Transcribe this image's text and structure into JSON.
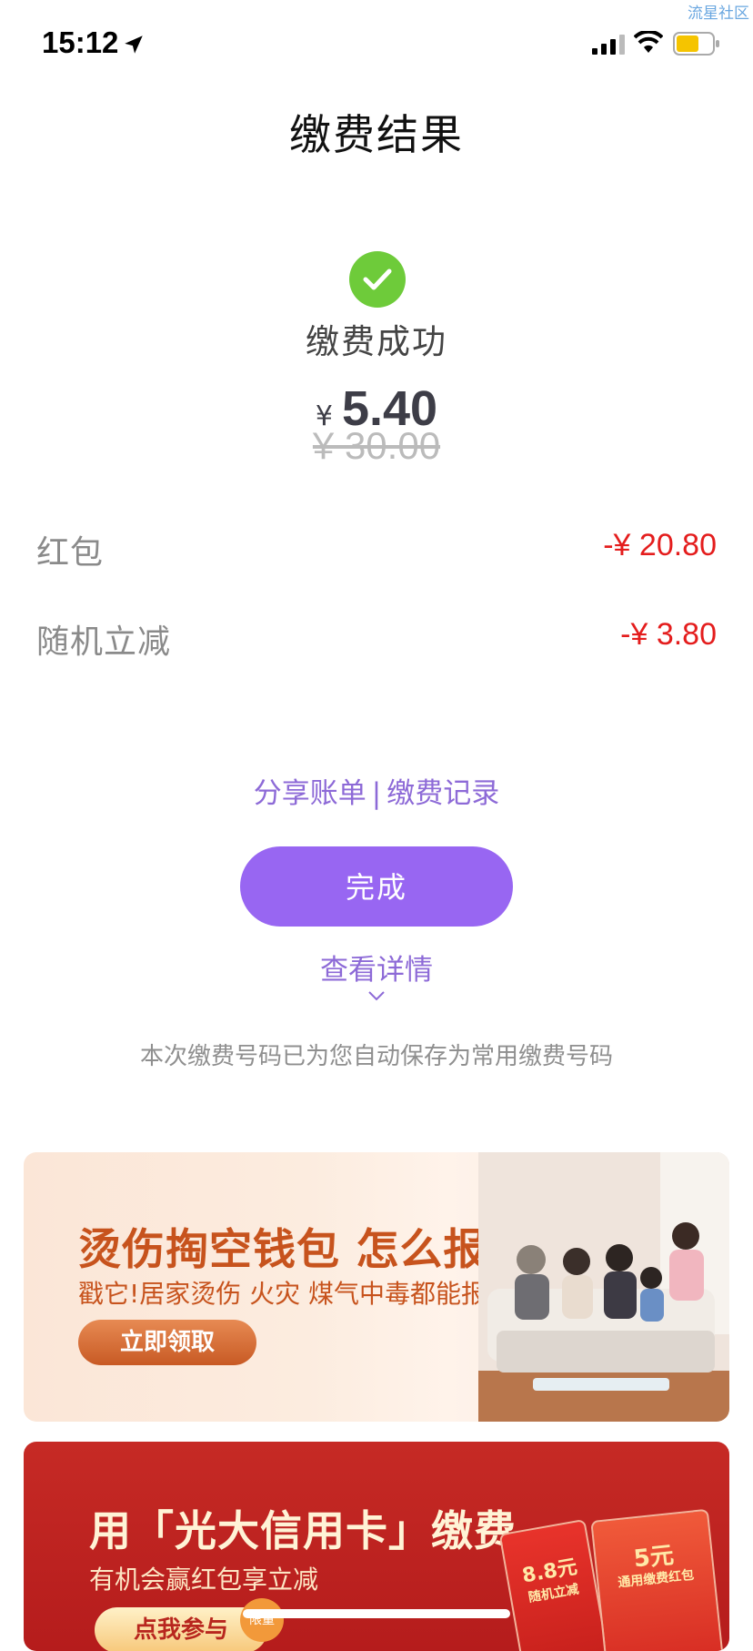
{
  "watermark": "流星社区",
  "status_bar": {
    "time": "15:12"
  },
  "header": {
    "title": "缴费结果"
  },
  "result": {
    "status_text": "缴费成功",
    "currency": "¥",
    "amount": "5.40",
    "original_amount": "¥ 30.00"
  },
  "details": [
    {
      "label": "红包",
      "value": "-¥ 20.80"
    },
    {
      "label": "随机立减",
      "value": "-¥ 3.80"
    }
  ],
  "links": {
    "share": "分享账单",
    "separator": "|",
    "records": "缴费记录"
  },
  "done_button": "完成",
  "view_details": "查看详情",
  "note": "本次缴费号码已为您自动保存为常用缴费号码",
  "banner1": {
    "title": "烫伤掏空钱包 怎么报?",
    "subtitle": "戳它!居家烫伤 火灾 煤气中毒都能报",
    "button": "立即领取"
  },
  "banner2": {
    "title": "用「光大信用卡」缴费",
    "subtitle": "有机会赢红包享立减",
    "button": "点我参与",
    "badge": "限量",
    "envelope1_amount": "8.8元",
    "envelope1_label": "随机立减",
    "envelope2_amount": "5元",
    "envelope2_label": "通用缴费红包"
  },
  "colors": {
    "accent": "#9866f2",
    "success": "#6ecb3a",
    "discount": "#e41d1d"
  }
}
